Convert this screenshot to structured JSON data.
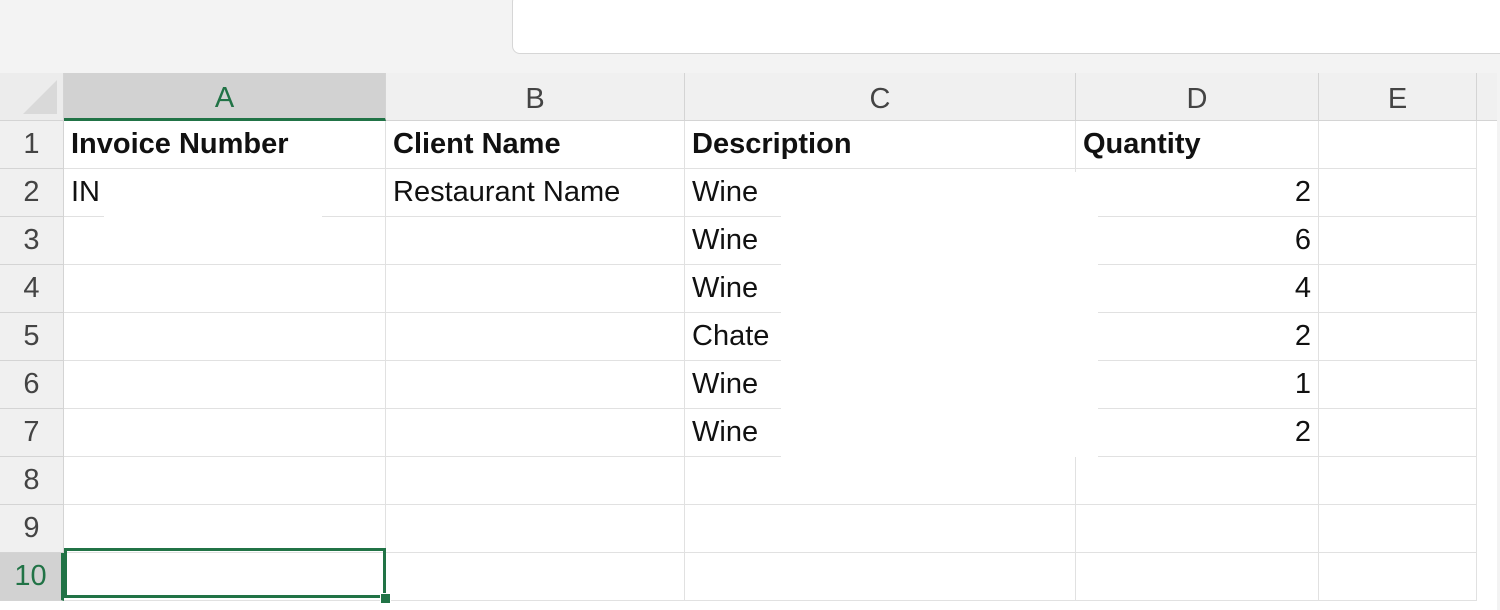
{
  "columns": [
    "A",
    "B",
    "C",
    "D",
    "E"
  ],
  "rows": [
    "1",
    "2",
    "3",
    "4",
    "5",
    "6",
    "7",
    "8",
    "9",
    "10"
  ],
  "selected_column": "A",
  "selected_row": "10",
  "headers": {
    "a1": "Invoice Number",
    "b1": "Client Name",
    "c1": "Description",
    "d1": "Quantity"
  },
  "cells": {
    "a2": "IN",
    "b2": "Restaurant Name",
    "c2": "Wine",
    "c3": "Wine",
    "c4": "Wine",
    "c5": "Chate",
    "c6": "Wine",
    "c7": "Wine",
    "d2": "2",
    "d3": "6",
    "d4": "4",
    "d5": "2",
    "d6": "1",
    "d7": "2"
  },
  "colors": {
    "accent": "#217346"
  }
}
